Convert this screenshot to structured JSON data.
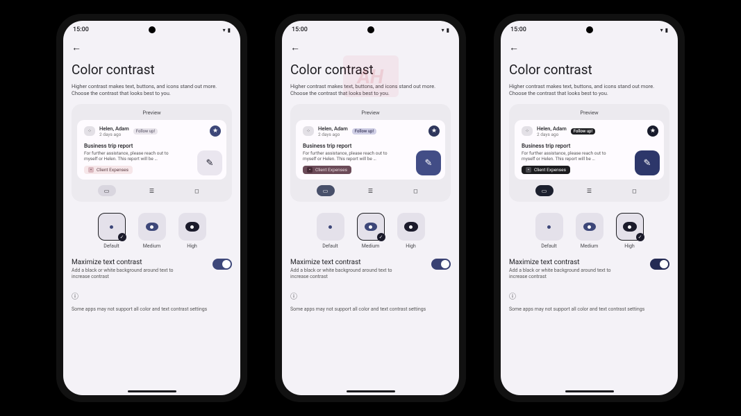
{
  "status": {
    "time": "15:00"
  },
  "page": {
    "title": "Color contrast",
    "subtitle": "Higher contrast makes text, buttons, and icons stand out more. Choose the contrast that looks best to you."
  },
  "preview": {
    "label": "Preview",
    "names": "Helen, Adam",
    "time": "2 days ago",
    "follow_chip": "Follow up!",
    "report_title": "Business trip report",
    "report_body": "For further assistance, please reach out to myself or Helen. This report will be …",
    "expense_chip": "Client Expenses"
  },
  "contrast_options": {
    "default": "Default",
    "medium": "Medium",
    "high": "High"
  },
  "maximize": {
    "title": "Maximize text contrast",
    "subtitle": "Add a black or white background around text to increase contrast"
  },
  "footer": "Some apps may not support all color and text contrast settings",
  "watermark": "AH",
  "phones": [
    {
      "selected": "default",
      "toggle_on": true,
      "watermark": false
    },
    {
      "selected": "medium",
      "toggle_on": true,
      "watermark": true
    },
    {
      "selected": "high",
      "toggle_on": true,
      "watermark": false
    }
  ]
}
